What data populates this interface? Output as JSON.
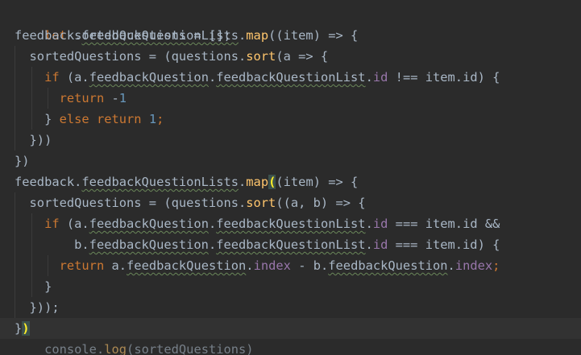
{
  "editor": {
    "lines": [
      [
        {
          "t": "let",
          "c": "kw"
        },
        {
          "t": " sortedQuestions = [];",
          "c": "pl"
        }
      ],
      [
        {
          "t": "feedback.",
          "c": "pl"
        },
        {
          "t": "feedbackQuestionLists",
          "c": "wv"
        },
        {
          "t": ".",
          "c": "pl"
        },
        {
          "t": "map",
          "c": "fn"
        },
        {
          "t": "((item) => {",
          "c": "pl"
        }
      ],
      [
        {
          "t": "  sortedQuestions = (questions.",
          "c": "pl"
        },
        {
          "t": "sort",
          "c": "fn"
        },
        {
          "t": "(a => {",
          "c": "pl"
        }
      ],
      [
        {
          "t": "    ",
          "c": "pl"
        },
        {
          "t": "if",
          "c": "kw"
        },
        {
          "t": " (a.",
          "c": "pl"
        },
        {
          "t": "feedbackQuestion",
          "c": "wv"
        },
        {
          "t": ".",
          "c": "pl"
        },
        {
          "t": "feedbackQuestionList",
          "c": "wv"
        },
        {
          "t": ".",
          "c": "pl"
        },
        {
          "t": "id",
          "c": "prop"
        },
        {
          "t": " !== item.id) {",
          "c": "pl"
        }
      ],
      [
        {
          "t": "      ",
          "c": "pl"
        },
        {
          "t": "return",
          "c": "kw"
        },
        {
          "t": " -",
          "c": "pl"
        },
        {
          "t": "1",
          "c": "num"
        }
      ],
      [
        {
          "t": "    } ",
          "c": "pl"
        },
        {
          "t": "else return",
          "c": "kw"
        },
        {
          "t": " ",
          "c": "pl"
        },
        {
          "t": "1",
          "c": "num"
        },
        {
          "t": ";",
          "c": "kw"
        }
      ],
      [
        {
          "t": "  }))",
          "c": "pl"
        }
      ],
      [
        {
          "t": "})",
          "c": "pl"
        }
      ],
      [
        {
          "t": "feedback.",
          "c": "pl"
        },
        {
          "t": "feedbackQuestionLists",
          "c": "wv"
        },
        {
          "t": ".",
          "c": "pl"
        },
        {
          "t": "map",
          "c": "fn"
        },
        {
          "t": "(",
          "c": "brace-match"
        },
        {
          "t": "(item) => {",
          "c": "pl"
        }
      ],
      [
        {
          "t": "  sortedQuestions = (questions.",
          "c": "pl"
        },
        {
          "t": "sort",
          "c": "fn"
        },
        {
          "t": "((a, b) => {",
          "c": "pl"
        }
      ],
      [
        {
          "t": "    ",
          "c": "pl"
        },
        {
          "t": "if",
          "c": "kw"
        },
        {
          "t": " (a.",
          "c": "pl"
        },
        {
          "t": "feedbackQuestion",
          "c": "wv"
        },
        {
          "t": ".",
          "c": "pl"
        },
        {
          "t": "feedbackQuestionList",
          "c": "wv"
        },
        {
          "t": ".",
          "c": "pl"
        },
        {
          "t": "id",
          "c": "prop"
        },
        {
          "t": " === item.id &&",
          "c": "pl"
        }
      ],
      [
        {
          "t": "        b.",
          "c": "pl"
        },
        {
          "t": "feedbackQuestion",
          "c": "wv"
        },
        {
          "t": ".",
          "c": "pl"
        },
        {
          "t": "feedbackQuestionList",
          "c": "wv"
        },
        {
          "t": ".",
          "c": "pl"
        },
        {
          "t": "id",
          "c": "prop"
        },
        {
          "t": " === item.id) {",
          "c": "pl"
        }
      ],
      [
        {
          "t": "      ",
          "c": "pl"
        },
        {
          "t": "return",
          "c": "kw"
        },
        {
          "t": " a.",
          "c": "pl"
        },
        {
          "t": "feedbackQuestion",
          "c": "wv"
        },
        {
          "t": ".",
          "c": "pl"
        },
        {
          "t": "index",
          "c": "prop"
        },
        {
          "t": " - b.",
          "c": "pl"
        },
        {
          "t": "feedbackQuestion",
          "c": "wv"
        },
        {
          "t": ".",
          "c": "pl"
        },
        {
          "t": "index",
          "c": "prop"
        },
        {
          "t": ";",
          "c": "kw"
        }
      ],
      [
        {
          "t": "    }",
          "c": "pl"
        }
      ],
      [
        {
          "t": "  }));",
          "c": "pl"
        }
      ],
      [
        {
          "t": "}",
          "c": "pl"
        },
        {
          "t": ")",
          "c": "brace-match"
        }
      ],
      [
        {
          "t": "    ",
          "c": "pl"
        },
        {
          "t": "console",
          "c": "pl"
        },
        {
          "t": ".",
          "c": "pl"
        },
        {
          "t": "log",
          "c": "fn"
        },
        {
          "t": "(sortedQuestions)",
          "c": "pl"
        }
      ]
    ]
  }
}
